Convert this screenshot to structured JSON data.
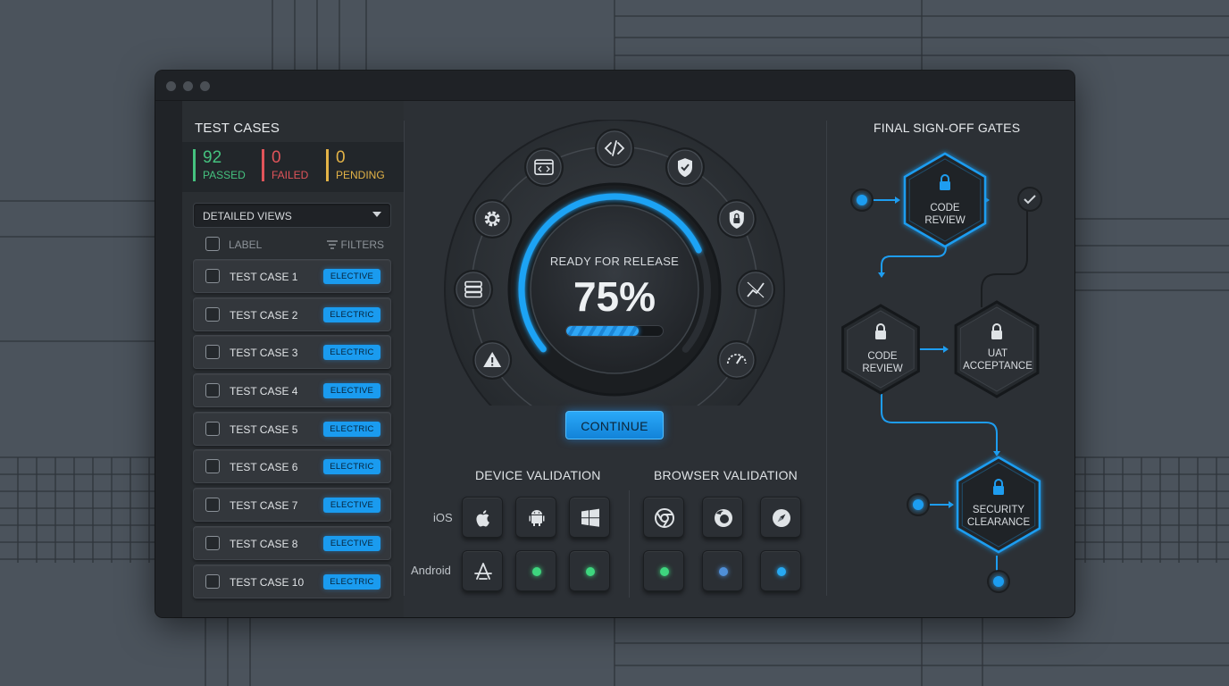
{
  "left_panel": {
    "title": "TEST CASES",
    "stats": [
      {
        "value": "92",
        "label": "PASSED",
        "color": "#45c27f"
      },
      {
        "value": "0",
        "label": "FAILED",
        "color": "#e0545a"
      },
      {
        "value": "0",
        "label": "PENDING",
        "color": "#e3b347"
      }
    ],
    "dropdown_value": "DETAILED VIEWS",
    "column_label": "LABEL",
    "filters_label": "FILTERS",
    "test_cases": [
      {
        "name": "TEST CASE 1",
        "badge": "ELECTIVE"
      },
      {
        "name": "TEST CASE 2",
        "badge": "ELECTRIC"
      },
      {
        "name": "TEST CASE 3",
        "badge": "ELECTRIC"
      },
      {
        "name": "TEST CASE 4",
        "badge": "ELECTIVE"
      },
      {
        "name": "TEST CASE 5",
        "badge": "ELECTRIC"
      },
      {
        "name": "TEST CASE 6",
        "badge": "ELECTRIC"
      },
      {
        "name": "TEST CASE 7",
        "badge": "ELECTIVE"
      },
      {
        "name": "TEST CASE 8",
        "badge": "ELECTIVE"
      },
      {
        "name": "TEST CASE 10",
        "badge": "ELECTRIC"
      }
    ]
  },
  "release": {
    "status_label": "READY FOR RELEASE",
    "percent_text": "75%",
    "progress": 0.75,
    "continue_label": "CONTINUE",
    "gauge_icons": [
      "warning-icon",
      "server-icon",
      "gear-icon",
      "browser-icon",
      "code-icon",
      "shield-check-icon",
      "lock-shield-icon",
      "chart-icon",
      "speedometer-icon"
    ]
  },
  "device_validation": {
    "title": "DEVICE VALIDATION",
    "row_labels": [
      "iOS",
      "Android"
    ],
    "tiles_row1": [
      "apple-icon",
      "android-icon",
      "windows-icon"
    ],
    "tiles_row2": [
      "app-store-icon",
      "status-led",
      "status-led"
    ],
    "led_colors": [
      "#3ed67e",
      "#3ed67e"
    ]
  },
  "browser_validation": {
    "title": "BROWSER VALIDATION",
    "tiles_row1": [
      "chrome-icon",
      "firefox-icon",
      "safari-icon"
    ],
    "led_colors": [
      "#3ed67e",
      "#4f8fd8",
      "#27a9f2"
    ]
  },
  "gates": {
    "title": "FINAL SIGN-OFF GATES",
    "nodes": [
      {
        "label": "CODE\nREVIEW",
        "style": "active"
      },
      {
        "label": "CODE\nREVIEW",
        "style": "idle"
      },
      {
        "label": "UAT\nACCEPTANCE",
        "style": "idle"
      },
      {
        "label": "SECURITY\nCLEARANCE",
        "style": "active"
      }
    ],
    "accent": "#1e9df0"
  }
}
